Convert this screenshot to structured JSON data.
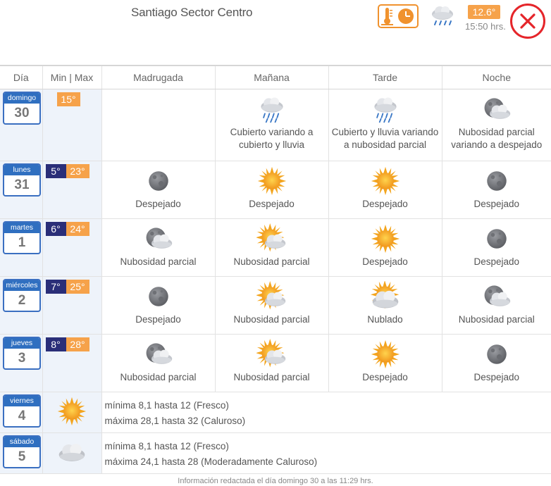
{
  "header": {
    "title": "Santiago Sector Centro",
    "current_temp": "12.6°",
    "time": "15:50 hrs."
  },
  "table": {
    "headers": [
      "Día",
      "Min | Max",
      "Madrugada",
      "Mañana",
      "Tarde",
      "Noche"
    ],
    "rows": [
      {
        "day": "domingo",
        "num": "30",
        "min": "",
        "max": "15°",
        "madrugada": {
          "icon": "",
          "text": ""
        },
        "manana": {
          "icon": "rain-cloud-icon",
          "text": "Cubierto variando a cubierto y lluvia"
        },
        "tarde": {
          "icon": "rain-cloud-icon",
          "text": "Cubierto y lluvia variando a nubosidad parcial"
        },
        "noche": {
          "icon": "moon-cloud-icon",
          "text": "Nubosidad parcial variando a despejado"
        }
      },
      {
        "day": "lunes",
        "num": "31",
        "min": "5°",
        "max": "23°",
        "madrugada": {
          "icon": "moon-icon",
          "text": "Despejado"
        },
        "manana": {
          "icon": "sun-icon",
          "text": "Despejado"
        },
        "tarde": {
          "icon": "sun-icon",
          "text": "Despejado"
        },
        "noche": {
          "icon": "moon-icon",
          "text": "Despejado"
        }
      },
      {
        "day": "martes",
        "num": "1",
        "min": "6°",
        "max": "24°",
        "madrugada": {
          "icon": "moon-cloud-icon",
          "text": "Nubosidad parcial"
        },
        "manana": {
          "icon": "sun-cloud-icon",
          "text": "Nubosidad parcial"
        },
        "tarde": {
          "icon": "sun-icon",
          "text": "Despejado"
        },
        "noche": {
          "icon": "moon-icon",
          "text": "Despejado"
        }
      },
      {
        "day": "miércoles",
        "num": "2",
        "min": "7°",
        "max": "25°",
        "madrugada": {
          "icon": "moon-icon",
          "text": "Despejado"
        },
        "manana": {
          "icon": "sun-cloud-icon",
          "text": "Nubosidad parcial"
        },
        "tarde": {
          "icon": "sun-clouds-icon",
          "text": "Nublado"
        },
        "noche": {
          "icon": "moon-cloud-icon",
          "text": "Nubosidad parcial"
        }
      },
      {
        "day": "jueves",
        "num": "3",
        "min": "8°",
        "max": "28°",
        "madrugada": {
          "icon": "moon-cloud-icon",
          "text": "Nubosidad parcial"
        },
        "manana": {
          "icon": "sun-cloud-icon",
          "text": "Nubosidad parcial"
        },
        "tarde": {
          "icon": "sun-icon",
          "text": "Despejado"
        },
        "noche": {
          "icon": "moon-icon",
          "text": "Despejado"
        }
      }
    ],
    "extended": [
      {
        "day": "viernes",
        "num": "4",
        "icon": "sun-icon",
        "min_text": "mínima 8,1 hasta 12 (Fresco)",
        "max_text": "máxima 28,1 hasta 32 (Caluroso)"
      },
      {
        "day": "sábado",
        "num": "5",
        "icon": "clouds-icon",
        "min_text": "mínima 8,1 hasta 12 (Fresco)",
        "max_text": "máxima 24,1 hasta 28 (Moderadamente Caluroso)"
      }
    ]
  },
  "footer": "Información redactada el día domingo 30 a las 11:29 hrs."
}
